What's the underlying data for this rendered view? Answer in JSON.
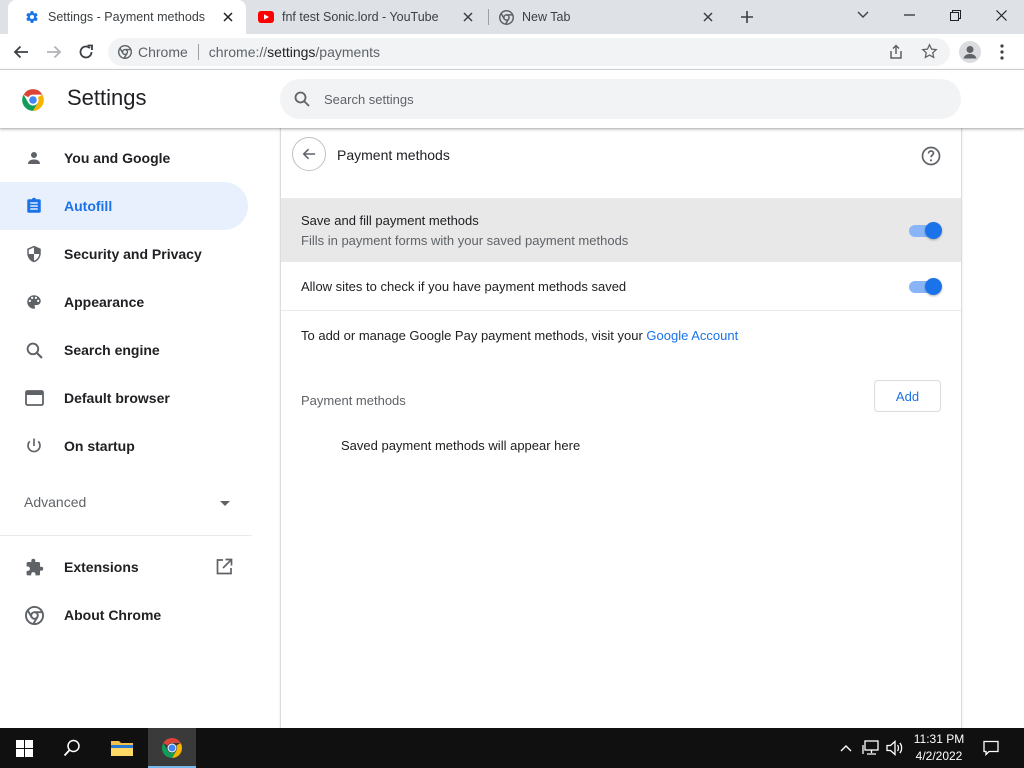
{
  "browser": {
    "tabs": [
      {
        "title": "Settings - Payment methods",
        "icon": "gear-icon",
        "active": true
      },
      {
        "title": "fnf test Sonic.lord - YouTube",
        "icon": "youtube-icon",
        "active": false
      },
      {
        "title": "New Tab",
        "icon": "chrome-icon",
        "active": false
      }
    ],
    "omnibox": {
      "site_label": "Chrome",
      "url_host": "chrome://",
      "url_path": "settings",
      "url_rest": "/payments"
    }
  },
  "settings": {
    "title": "Settings",
    "search_placeholder": "Search settings",
    "nav": [
      {
        "label": "You and Google",
        "icon": "person-icon"
      },
      {
        "label": "Autofill",
        "icon": "clipboard-icon",
        "active": true
      },
      {
        "label": "Security and Privacy",
        "icon": "shield-icon"
      },
      {
        "label": "Appearance",
        "icon": "palette-icon"
      },
      {
        "label": "Search engine",
        "icon": "search-icon"
      },
      {
        "label": "Default browser",
        "icon": "browser-window-icon"
      },
      {
        "label": "On startup",
        "icon": "power-icon"
      }
    ],
    "advanced_label": "Advanced",
    "extensions_label": "Extensions",
    "about_label": "About Chrome"
  },
  "page": {
    "title": "Payment methods",
    "save_fill": {
      "title": "Save and fill payment methods",
      "subtitle": "Fills in payment forms with your saved payment methods",
      "enabled": true
    },
    "allow_check": {
      "title": "Allow sites to check if you have payment methods saved",
      "enabled": true
    },
    "gpay_text": "To add or manage Google Pay payment methods, visit your",
    "gpay_link": "Google Account",
    "section_label": "Payment methods",
    "add_label": "Add",
    "empty_text": "Saved payment methods will appear here"
  },
  "taskbar": {
    "time": "11:31 PM",
    "date": "4/2/2022"
  },
  "colors": {
    "accent": "#1a73e8",
    "nav_active_bg": "#e8f0fe",
    "highlight_row": "#e8e8e8"
  }
}
